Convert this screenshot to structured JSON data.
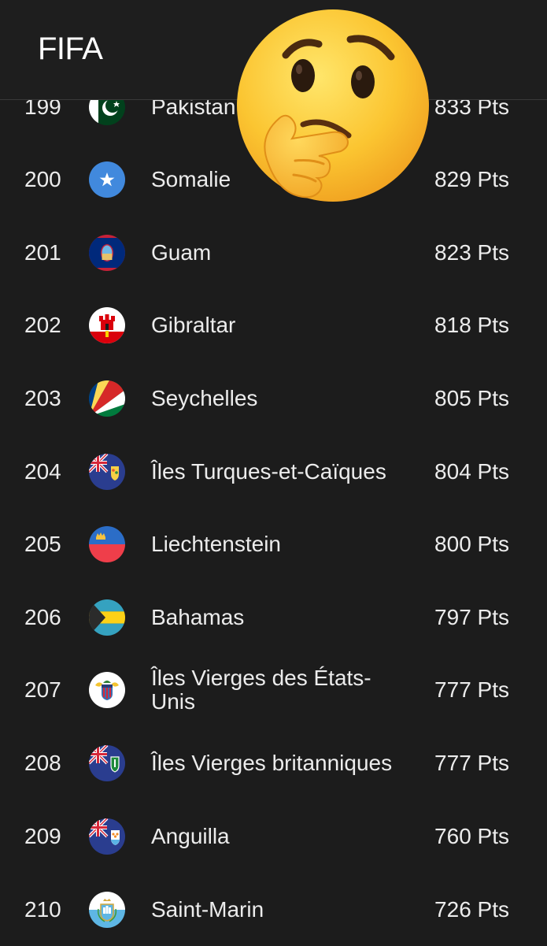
{
  "header": {
    "title": "FIFA"
  },
  "rows": [
    {
      "rank": "199",
      "name": "Pakistan",
      "points": "833 Pts",
      "flag": "pakistan-flag"
    },
    {
      "rank": "200",
      "name": "Somalie",
      "points": "829 Pts",
      "flag": "somalia-flag"
    },
    {
      "rank": "201",
      "name": "Guam",
      "points": "823 Pts",
      "flag": "guam-flag"
    },
    {
      "rank": "202",
      "name": "Gibraltar",
      "points": "818 Pts",
      "flag": "gibraltar-flag"
    },
    {
      "rank": "203",
      "name": "Seychelles",
      "points": "805 Pts",
      "flag": "seychelles-flag"
    },
    {
      "rank": "204",
      "name": "Îles Turques-et-Caïques",
      "points": "804 Pts",
      "flag": "turks-caicos-flag"
    },
    {
      "rank": "205",
      "name": "Liechtenstein",
      "points": "800 Pts",
      "flag": "liechtenstein-flag"
    },
    {
      "rank": "206",
      "name": "Bahamas",
      "points": "797 Pts",
      "flag": "bahamas-flag"
    },
    {
      "rank": "207",
      "name": "Îles Vierges des États-Unis",
      "points": "777 Pts",
      "flag": "us-virgin-islands-flag"
    },
    {
      "rank": "208",
      "name": "Îles Vierges britanniques",
      "points": "777 Pts",
      "flag": "british-virgin-islands-flag"
    },
    {
      "rank": "209",
      "name": "Anguilla",
      "points": "760 Pts",
      "flag": "anguilla-flag"
    },
    {
      "rank": "210",
      "name": "Saint-Marin",
      "points": "726 Pts",
      "flag": "san-marino-flag"
    }
  ],
  "overlay": {
    "icon": "thinking-face-emoji"
  },
  "colors": {
    "background": "#1c1c1c",
    "header": "#1e1e1e",
    "text": "#ececec"
  }
}
